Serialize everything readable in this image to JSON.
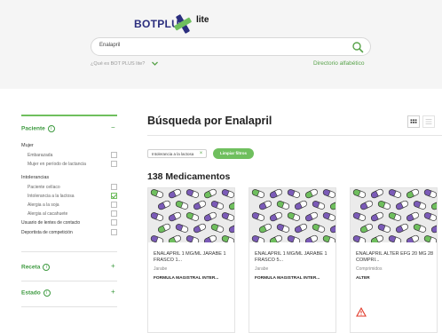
{
  "header": {
    "logo_text": "BOTPLUS",
    "logo_sub": "lite",
    "search_value": "Enalapril",
    "what_link": "¿Qué es BOT PLUS lite?",
    "directory_link": "Directorio alfabético"
  },
  "filters": {
    "paciente": {
      "label": "Paciente",
      "toggle": "−",
      "groups": [
        {
          "label": "Mujer",
          "options": [
            {
              "label": "Embarazada",
              "checked": false
            },
            {
              "label": "Mujer en período de lactancia",
              "checked": false
            }
          ]
        },
        {
          "label": "Intolerancias",
          "options": [
            {
              "label": "Paciente celíaco",
              "checked": false
            },
            {
              "label": "Intolerancia a la lactosa",
              "checked": true
            },
            {
              "label": "Alergia a la soja",
              "checked": false
            },
            {
              "label": "Alergia al cacahuete",
              "checked": false
            }
          ]
        }
      ],
      "extra": [
        {
          "label": "Usuario de lentes de contacto",
          "checked": false
        },
        {
          "label": "Deportista de competición",
          "checked": false
        }
      ]
    },
    "receta": {
      "label": "Receta",
      "toggle": "+"
    },
    "estado": {
      "label": "Estado",
      "toggle": "+"
    }
  },
  "main": {
    "title": "Búsqueda por Enalapril",
    "active_chip": "Intolerancia a la lactosa",
    "chip_remove": "×",
    "clear_button": "Limpiar filtros",
    "count": "138 Medicamentos",
    "cards": [
      {
        "name": "ENALAPRIL 1 MG/ML JARABE 1 FRASCO 1...",
        "form": "Jarabe",
        "lab": "FORMULA MAGISTRAL INTER...",
        "warning": false
      },
      {
        "name": "ENALAPRIL 1 MG/ML JARABE 1 FRASCO 5...",
        "form": "Jarabe",
        "lab": "FORMULA MAGISTRAL INTER...",
        "warning": false
      },
      {
        "name": "ENALAPRIL ALTER EFG 20 MG 28 COMPRI...",
        "form": "Comprimidos",
        "lab": "ALTER",
        "warning": true
      }
    ]
  },
  "colors": {
    "brand_navy": "#2b2e7e",
    "brand_green": "#6fbf5e",
    "pill_purple": "#7b5bb8",
    "pill_green": "#6fbf5e",
    "warning_red": "#e23a2a"
  }
}
